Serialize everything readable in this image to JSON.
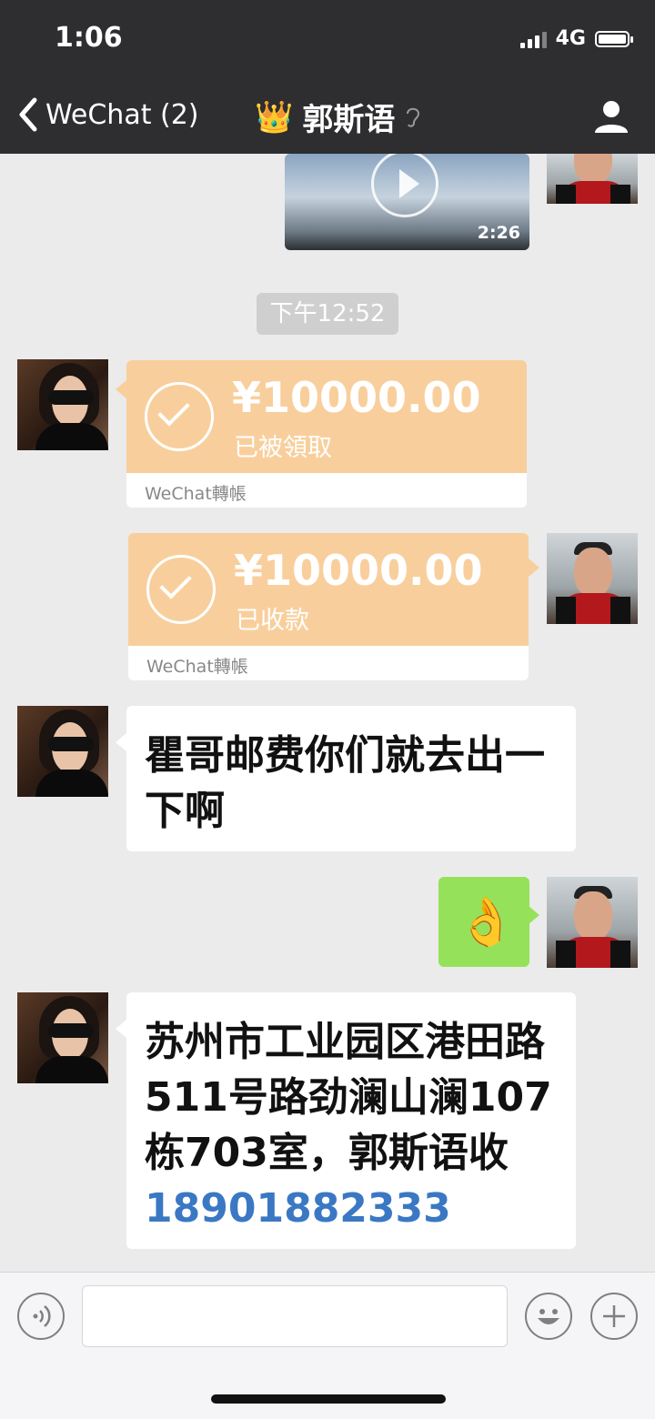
{
  "status": {
    "time": "1:06",
    "network": "4G"
  },
  "nav": {
    "back_label": "WeChat (2)",
    "title": "郭斯语",
    "crown": "👑",
    "ear_icon": "ear-icon"
  },
  "video": {
    "duration": "2:26"
  },
  "timestamp": "下午12:52",
  "messages": {
    "transfer_received": {
      "amount": "¥10000.00",
      "state": "已被領取",
      "footer": "WeChat轉帳"
    },
    "transfer_accepted": {
      "amount": "¥10000.00",
      "state": "已收款",
      "footer": "WeChat轉帳"
    },
    "text1": "瞿哥邮费你们就去出一下啊",
    "emoji_reply": "👌",
    "address_text": "苏州市工业园区港田路511号路劲澜山澜107栋703室，郭斯语收",
    "address_phone": "18901882333"
  },
  "colors": {
    "transfer_bg": "#f8cf9c",
    "sent_bubble": "#95e25a",
    "link": "#3a78c4",
    "topbar": "#2e2e30"
  }
}
